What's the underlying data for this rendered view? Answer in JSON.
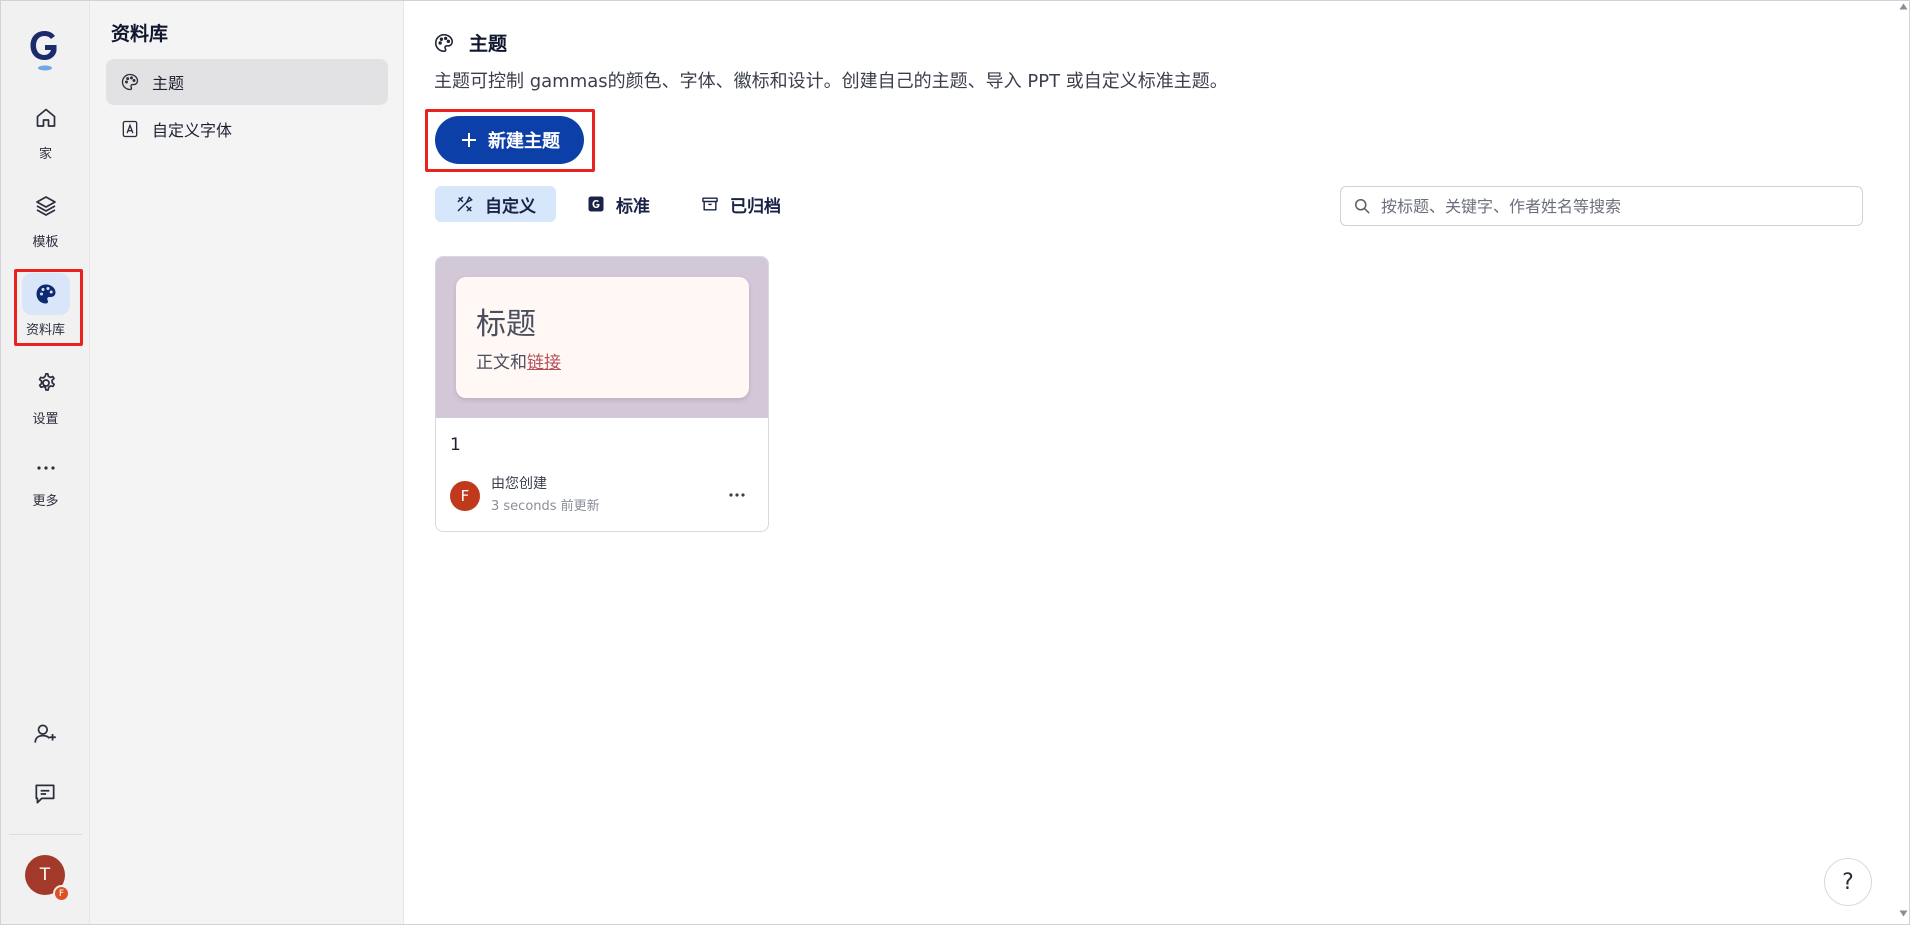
{
  "rail": {
    "logo_icon": "gamma-logo",
    "items": [
      {
        "label": "家",
        "icon": "home-icon"
      },
      {
        "label": "模板",
        "icon": "layers-icon"
      },
      {
        "label": "资料库",
        "icon": "palette-icon",
        "active": true
      },
      {
        "label": "设置",
        "icon": "gear-icon"
      },
      {
        "label": "更多",
        "icon": "more-icon"
      }
    ],
    "bottom_icons": [
      "add-user-icon",
      "feedback-icon"
    ],
    "avatar_initial": "T",
    "avatar_badge": "F",
    "accent_color": "#0c3fa8",
    "highlight_color": "#e8221e"
  },
  "sidebar": {
    "title": "资料库",
    "items": [
      {
        "label": "主题",
        "icon": "palette-icon",
        "active": true
      },
      {
        "label": "自定义字体",
        "icon": "font-icon"
      }
    ]
  },
  "main": {
    "title": "主题",
    "description": "主题可控制 gammas的颜色、字体、徽标和设计。创建自己的主题、导入 PPT 或自定义标准主题。",
    "new_button_label": "新建主题",
    "tabs": [
      {
        "label": "自定义",
        "icon": "custom-design-icon",
        "active": true
      },
      {
        "label": "标准",
        "icon": "gamma-standard-icon"
      },
      {
        "label": "已归档",
        "icon": "archive-icon"
      }
    ],
    "search_placeholder": "按标题、关键字、作者姓名等搜索",
    "search_value": "",
    "theme_card": {
      "preview_title": "标题",
      "preview_body": "正文和",
      "preview_link": "链接",
      "preview_bg": "#d3c8d8",
      "name": "1",
      "avatar_initial": "F",
      "created_by": "由您创建",
      "updated": "3 seconds 前更新"
    },
    "help_label": "?"
  }
}
